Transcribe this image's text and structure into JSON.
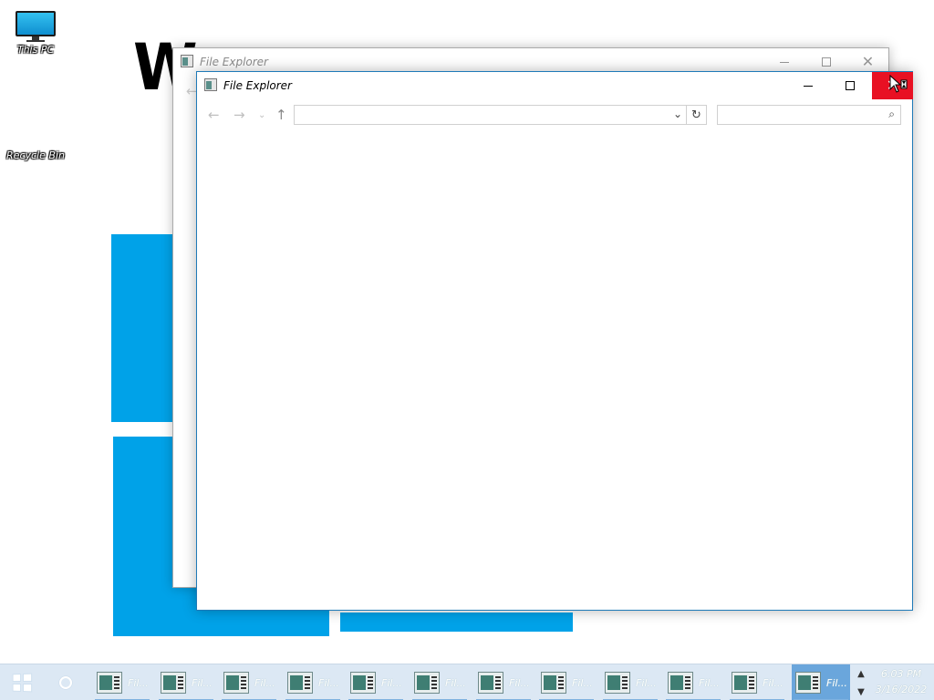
{
  "desktop": {
    "wallpaper_text": "W",
    "icons": [
      {
        "label": "This PC",
        "icon": "monitor-icon"
      },
      {
        "label": "Recycle Bin",
        "icon": "recycle-bin-icon"
      }
    ]
  },
  "windows": {
    "back": {
      "title": "File Explorer",
      "buttons": {
        "minimize": "minimize",
        "maximize": "maximize",
        "close": "close"
      }
    },
    "front": {
      "title": "File Explorer",
      "nav": {
        "back_icon": "←",
        "forward_icon": "→",
        "recent_icon": "⌄",
        "up_icon": "↑",
        "address_value": "",
        "search_value": ""
      },
      "close_color": "#e81123"
    }
  },
  "taskbar": {
    "items": [
      {
        "label": "Fil..."
      },
      {
        "label": "Fil..."
      },
      {
        "label": "Fil..."
      },
      {
        "label": "Fil..."
      },
      {
        "label": "Fil..."
      },
      {
        "label": "Fil..."
      },
      {
        "label": "Fil..."
      },
      {
        "label": "Fil..."
      },
      {
        "label": "Fil..."
      },
      {
        "label": "Fil..."
      },
      {
        "label": "Fil..."
      },
      {
        "label": "Fil...",
        "active": true
      }
    ],
    "time": "6:03 PM",
    "date": "3/16/2022",
    "accent": "#6aa6dc"
  }
}
